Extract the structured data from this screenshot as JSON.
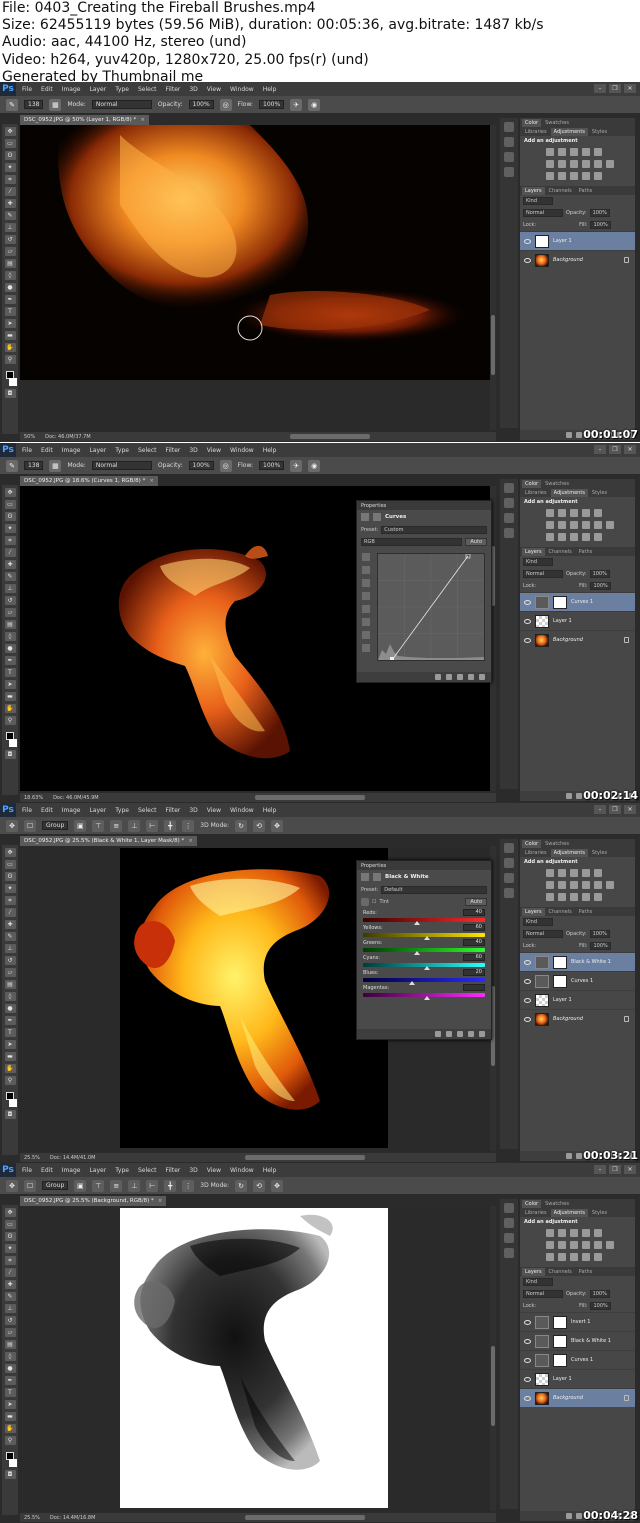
{
  "header": {
    "lines": [
      "File: 0403_Creating the Fireball Brushes.mp4",
      "Size: 62455119 bytes (59.56 MiB), duration: 00:05:36, avg.bitrate: 1487 kb/s",
      "Audio: aac, 44100 Hz, stereo (und)",
      "Video: h264, yuv420p, 1280x720, 25.00 fps(r) (und)",
      "Generated by Thumbnail me"
    ]
  },
  "app": {
    "logo": "Ps",
    "menu": [
      "File",
      "Edit",
      "Image",
      "Layer",
      "Type",
      "Select",
      "Filter",
      "3D",
      "View",
      "Window",
      "Help"
    ],
    "window_controls": [
      "–",
      "❐",
      "✕"
    ]
  },
  "brush_options": {
    "size": "138",
    "mode_label": "Mode:",
    "mode_value": "Normal",
    "opacity_label": "Opacity:",
    "opacity_value": "100%",
    "flow_label": "Flow:",
    "flow_value": "100%"
  },
  "move_options": {
    "auto_select": "Group",
    "mode_3d": "3D Mode:"
  },
  "panels": {
    "color_tabs": [
      "Color",
      "Swatches"
    ],
    "adj_tabs": [
      "Libraries",
      "Adjustments",
      "Styles"
    ],
    "add_adjustment": "Add an adjustment",
    "layer_tabs": [
      "Layers",
      "Channels",
      "Paths"
    ],
    "kind": "Kind",
    "blend": "Normal",
    "opacity_label": "Opacity:",
    "opacity_value": "100%",
    "lock_label": "Lock:",
    "fill_label": "Fill:",
    "fill_value": "100%"
  },
  "frames": [
    {
      "doc_tab": "DSC_0952.JPG @ 50% (Layer 1, RGB/8) *",
      "zoom": "50%",
      "doc_size": "Doc: 46.0M/37.7M",
      "timestamp": "00:01:07",
      "layers": [
        {
          "name": "Layer 1",
          "thumb": "white",
          "selected": true
        },
        {
          "name": "Background",
          "thumb": "fire",
          "italic": true,
          "lock": true
        }
      ]
    },
    {
      "doc_tab": "DSC_0952.JPG @ 18.6% (Curves 1, RGB/8) *",
      "zoom": "18.63%",
      "doc_size": "Doc: 46.0M/45.9M",
      "timestamp": "00:02:14",
      "props_title": "Properties",
      "props_name": "Curves",
      "preset_label": "Preset:",
      "preset_value": "Custom",
      "channel": "RGB",
      "auto": "Auto",
      "layers": [
        {
          "name": "Curves 1",
          "thumb": "adj",
          "selected": true
        },
        {
          "name": "Layer 1",
          "thumb": "checker"
        },
        {
          "name": "Background",
          "thumb": "fire",
          "italic": true,
          "lock": true
        }
      ]
    },
    {
      "doc_tab": "DSC_0952.JPG @ 25.5% (Black & White 1, Layer Mask/8) *",
      "zoom": "25.5%",
      "doc_size": "Doc: 14.4M/41.0M",
      "timestamp": "00:03:21",
      "props_title": "Properties",
      "props_name": "Black & White",
      "preset_label": "Preset:",
      "preset_value": "Default",
      "tint_label": "Tint",
      "auto": "Auto",
      "sliders": [
        {
          "label": "Reds:",
          "value": "40",
          "pos": 0.42,
          "track": "linear-gradient(90deg,#3a0000,#ff2a2a)"
        },
        {
          "label": "Yellows:",
          "value": "60",
          "pos": 0.5,
          "track": "linear-gradient(90deg,#3a3a00,#ffe600)"
        },
        {
          "label": "Greens:",
          "value": "40",
          "pos": 0.42,
          "track": "linear-gradient(90deg,#003a00,#2aff2a)"
        },
        {
          "label": "Cyans:",
          "value": "60",
          "pos": 0.5,
          "track": "linear-gradient(90deg,#003a3a,#2affff)"
        },
        {
          "label": "Blues:",
          "value": "20",
          "pos": 0.38,
          "track": "linear-gradient(90deg,#00003a,#2a2aff)"
        },
        {
          "label": "Magentas:",
          "value": "",
          "pos": 0.5,
          "track": "linear-gradient(90deg,#3a003a,#ff2aff)"
        }
      ],
      "layers": [
        {
          "name": "Black & White 1",
          "thumb": "adj",
          "selected": true
        },
        {
          "name": "Curves 1",
          "thumb": "adj"
        },
        {
          "name": "Layer 1",
          "thumb": "checker"
        },
        {
          "name": "Background",
          "thumb": "fire",
          "italic": true,
          "lock": true
        }
      ]
    },
    {
      "doc_tab": "DSC_0952.JPG @ 25.5% (Background, RGB/8) *",
      "zoom": "25.5%",
      "doc_size": "Doc: 14.4M/16.8M",
      "timestamp": "00:04:28",
      "layers": [
        {
          "name": "Invert 1",
          "thumb": "adj"
        },
        {
          "name": "Black & White 1",
          "thumb": "adj"
        },
        {
          "name": "Curves 1",
          "thumb": "adj"
        },
        {
          "name": "Layer 1",
          "thumb": "checker"
        },
        {
          "name": "Background",
          "thumb": "fire",
          "italic": true,
          "lock": true,
          "selected": true
        }
      ]
    }
  ]
}
